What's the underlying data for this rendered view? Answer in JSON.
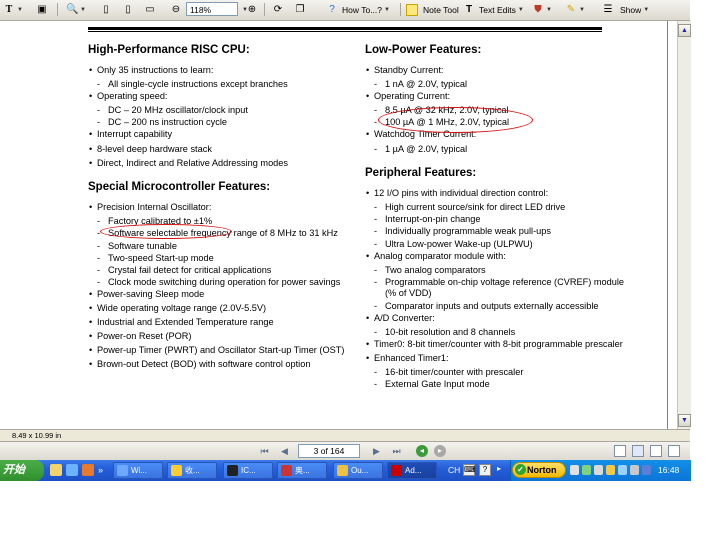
{
  "toolbar": {
    "select_tool": "T",
    "zoom_value": "118%",
    "howto_label": "How To...?",
    "note_tool_label": "Note Tool",
    "text_edits_label": "Text Edits",
    "show_label": "Show"
  },
  "document": {
    "left": {
      "h1": "High-Performance RISC CPU:",
      "cpu": [
        {
          "level": 1,
          "text": "Only 35 instructions to learn:"
        },
        {
          "level": 2,
          "text": "All single-cycle instructions except branches"
        },
        {
          "level": 1,
          "text": "Operating speed:"
        },
        {
          "level": 2,
          "text": "DC – 20 MHz oscillator/clock input"
        },
        {
          "level": 2,
          "text": "DC – 200 ns instruction cycle"
        },
        {
          "level": 1,
          "text": "Interrupt capability"
        },
        {
          "level": 1,
          "text": "8-level deep hardware stack"
        },
        {
          "level": 1,
          "text": "Direct, Indirect and Relative Addressing modes"
        }
      ],
      "h2": "Special Microcontroller Features:",
      "special": [
        {
          "level": 1,
          "text": "Precision Internal Oscillator:"
        },
        {
          "level": 2,
          "text": "Factory calibrated to ±1%"
        },
        {
          "level": 2,
          "text": "Software selectable frequency range of 8 MHz to 31 kHz"
        },
        {
          "level": 2,
          "text": "Software tunable"
        },
        {
          "level": 2,
          "text": "Two-speed Start-up mode"
        },
        {
          "level": 2,
          "text": "Crystal fail detect for critical applications"
        },
        {
          "level": 2,
          "text": "Clock mode switching during operation for power savings"
        },
        {
          "level": 1,
          "text": "Power-saving Sleep mode"
        },
        {
          "level": 1,
          "text": "Wide operating voltage range (2.0V-5.5V)"
        },
        {
          "level": 1,
          "text": "Industrial and Extended Temperature range"
        },
        {
          "level": 1,
          "text": "Power-on Reset (POR)"
        },
        {
          "level": 1,
          "text": "Power-up Timer (PWRT) and Oscillator Start-up Timer (OST)"
        },
        {
          "level": 1,
          "text": "Brown-out Detect (BOD) with software control option"
        }
      ]
    },
    "right": {
      "h1": "Low-Power Features:",
      "low": [
        {
          "level": 1,
          "text": "Standby Current:"
        },
        {
          "level": 2,
          "text": "1 nA @ 2.0V, typical"
        },
        {
          "level": 1,
          "text": "Operating Current:"
        },
        {
          "level": 2,
          "text": "8.5 µA @ 32 kHz, 2.0V, typical"
        },
        {
          "level": 2,
          "text": "100 µA @ 1 MHz, 2.0V, typical"
        },
        {
          "level": 1,
          "text": "Watchdog Timer Current:"
        },
        {
          "level": 2,
          "text": "1 µA @ 2.0V, typical"
        }
      ],
      "h2": "Peripheral Features:",
      "periph": [
        {
          "level": 1,
          "text": "12 I/O pins with individual direction control:"
        },
        {
          "level": 2,
          "text": "High current source/sink for direct LED drive"
        },
        {
          "level": 2,
          "text": "Interrupt-on-pin change"
        },
        {
          "level": 2,
          "text": "Individually programmable weak pull-ups"
        },
        {
          "level": 2,
          "text": "Ultra Low-power Wake-up (ULPWU)"
        },
        {
          "level": 1,
          "text": "Analog comparator module with:"
        },
        {
          "level": 2,
          "text": "Two analog comparators"
        },
        {
          "level": 2,
          "text": "Programmable on-chip voltage reference (CVREF) module (% of VDD)"
        },
        {
          "level": 2,
          "text": "Comparator inputs and outputs externally accessible"
        },
        {
          "level": 1,
          "text": "A/D Converter:"
        },
        {
          "level": 2,
          "text": "10-bit resolution and 8 channels"
        },
        {
          "level": 1,
          "text": "Timer0: 8-bit timer/counter with 8-bit programmable prescaler"
        },
        {
          "level": 1,
          "text": "Enhanced Timer1:"
        },
        {
          "level": 2,
          "text": "16-bit timer/counter with prescaler"
        },
        {
          "level": 2,
          "text": "External Gate Input mode"
        }
      ]
    }
  },
  "status": {
    "page_size": "8.49 x 10.99 in",
    "page_indicator": "3 of 164"
  },
  "taskbar": {
    "start_label": "开始",
    "tasks": [
      {
        "label": "Wi...",
        "icon_color": "#6fa8ff"
      },
      {
        "label": "收...",
        "icon_color": "#ffcc33"
      },
      {
        "label": "IC...",
        "icon_color": "#222222"
      },
      {
        "label": "奥...",
        "icon_color": "#cc3333"
      },
      {
        "label": "Ou...",
        "icon_color": "#f0c040"
      },
      {
        "label": "Ad...",
        "icon_color": "#cc0000"
      }
    ],
    "lang": "CH",
    "norton_label": "Norton",
    "clock": "16:48"
  },
  "colors": {
    "annotation": "#d81010",
    "taskbar": "#245edb",
    "start": "#3a9d38"
  }
}
